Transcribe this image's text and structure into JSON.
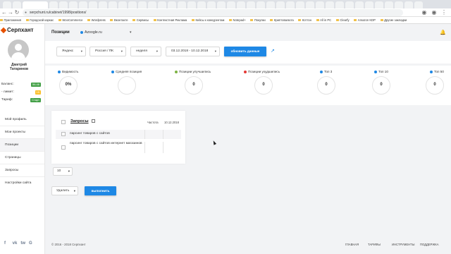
{
  "browser": {
    "url": "serpchunt.ru/cabinet/1998/positions/",
    "bookmarks": [
      "Приложения",
      "Городской каркас",
      "WooCommerce",
      "Wordpress",
      "Вконтакте",
      "Сервисы",
      "Контекстная Реклама",
      "Кейсы к конкурентам",
      "Notepad+",
      "Покупки",
      "Криптовалюта",
      "Коттон",
      "All in PC",
      "Clearfy",
      "Amazon KDP",
      "Другие закладки"
    ]
  },
  "sidebar": {
    "logo": "Серпхант",
    "user_name_line1": "Дмитрий",
    "user_name_line2": "Татаринов",
    "stats": [
      {
        "label": "Баланс:",
        "badge": "56.46",
        "color": "#43a047"
      },
      {
        "label": "- лимит:",
        "badge": "15",
        "color": "#fbc02d"
      },
      {
        "label": "Тариф:",
        "badge": "Старт",
        "color": "#43a047"
      }
    ],
    "menu": [
      "Мой профиль",
      "Мои проекты",
      "Позиции",
      "Страницы",
      "Запросы",
      "Настройки сайта"
    ],
    "active_menu_index": 2,
    "socials": [
      "f",
      "vk",
      "tw",
      "G"
    ]
  },
  "header": {
    "title": "Позиции",
    "site": "Azoogle.ru"
  },
  "filters": {
    "search_engine": "Яндекс",
    "region": "Россия / ПК",
    "period": "неделя",
    "date_range": "03.12.2018 - 10.12.2018",
    "update_button": "обновить данные"
  },
  "stats": [
    {
      "label": "Видимость",
      "value": "0%",
      "color": "#1e88e5"
    },
    {
      "label": "Средняя позиция",
      "value": "",
      "color": "#1e88e5"
    },
    {
      "label": "Позиции улучшились",
      "value": "0",
      "color": "#7cb342"
    },
    {
      "label": "Позиции ухудшились",
      "value": "0",
      "color": "#e53935"
    },
    {
      "label": "Топ 3",
      "value": "0",
      "color": "#1e88e5"
    },
    {
      "label": "Топ 10",
      "value": "0",
      "color": "#1e88e5"
    },
    {
      "label": "Топ 50",
      "value": "0",
      "color": "#1e88e5"
    }
  ],
  "queries": {
    "title": "Запросы",
    "col_frequency": "Частота",
    "col_date": "10.12.2018",
    "rows": [
      "парсинг товаров с сайтов",
      "парсинг товаров с сайтов интернет магазинов"
    ]
  },
  "pager": {
    "value": "10"
  },
  "bulk": {
    "action": "Удалить",
    "run_button": "выполнить"
  },
  "footer": {
    "copyright": "© 2016 - 2018 Серпхант",
    "links": [
      "ГЛАВНАЯ",
      "ТАРИФЫ",
      "ИНСТРУМЕНТЫ",
      "ПОДДЕРЖКА"
    ]
  }
}
